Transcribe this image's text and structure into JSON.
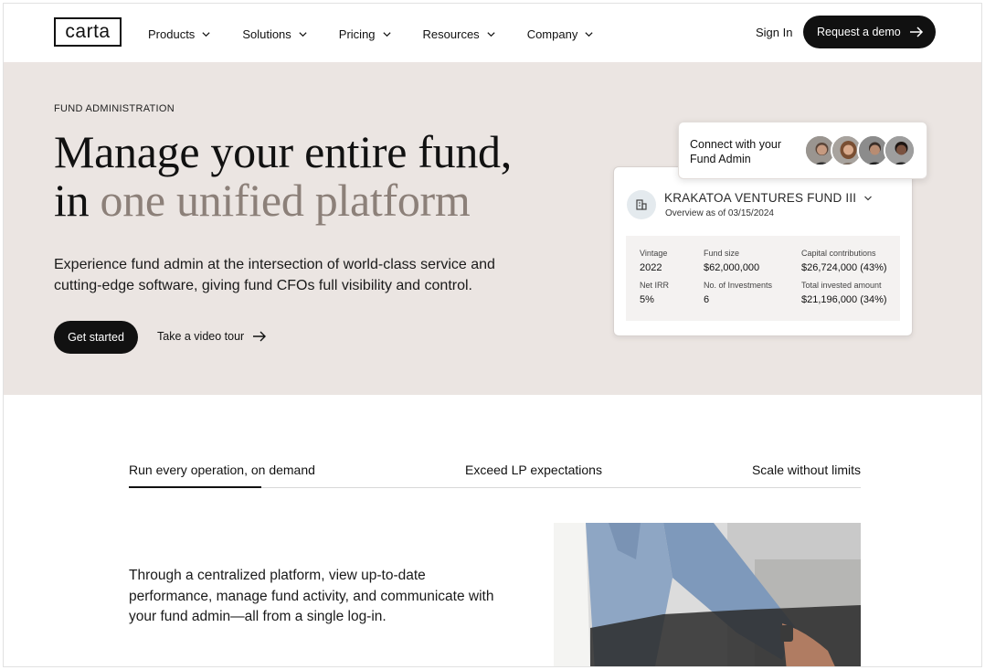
{
  "nav": {
    "logo": "carta",
    "items": [
      {
        "label": "Products"
      },
      {
        "label": "Solutions"
      },
      {
        "label": "Pricing"
      },
      {
        "label": "Resources"
      },
      {
        "label": "Company"
      }
    ],
    "sign_in": "Sign In",
    "request_demo": "Request a demo"
  },
  "hero": {
    "eyebrow": "FUND ADMINISTRATION",
    "headline_line1": "Manage your entire fund,",
    "headline_line2_prefix": "in ",
    "headline_line2_muted": "one unified platform",
    "subtitle": "Experience fund admin at the intersection of world-class service and cutting-edge software, giving fund CFOs full visibility and control.",
    "get_started": "Get started",
    "video_tour": "Take a video tour"
  },
  "connect_card": {
    "text": "Connect with your Fund Admin"
  },
  "fund_card": {
    "name": "KRAKATOA VENTURES FUND III",
    "as_of": "Overview as of 03/15/2024",
    "stats": [
      {
        "label": "Vintage",
        "value": "2022"
      },
      {
        "label": "Fund size",
        "value": "$62,000,000"
      },
      {
        "label": "Capital contributions",
        "value": "$26,724,000 (43%)"
      },
      {
        "label": "Net IRR",
        "value": "5%"
      },
      {
        "label": "No. of Investments",
        "value": "6"
      },
      {
        "label": "Total invested amount",
        "value": "$21,196,000 (34%)"
      }
    ]
  },
  "tabs": [
    {
      "label": "Run every operation, on demand",
      "active": true
    },
    {
      "label": "Exceed LP expectations",
      "active": false
    },
    {
      "label": "Scale without limits",
      "active": false
    }
  ],
  "section": {
    "body": "Through a centralized platform, view up-to-date performance, manage fund activity, and communicate with your fund admin—all from a single log-in."
  },
  "colors": {
    "hero_bg": "#ebe5e2",
    "headline_muted": "#8c8079",
    "primary_button": "#111111"
  },
  "icons": [
    "chevron-down-icon",
    "arrow-right-icon",
    "building-icon"
  ]
}
